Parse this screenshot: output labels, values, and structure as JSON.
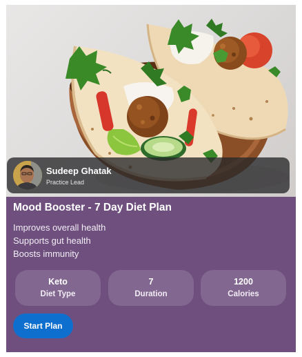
{
  "author": {
    "name": "Sudeep Ghatak",
    "role": "Practice Lead"
  },
  "plan": {
    "title": "Mood Booster - 7 Day Diet Plan",
    "benefits": [
      "Improves overall health",
      "Supports gut health",
      "Boosts immunity"
    ]
  },
  "stats": [
    {
      "value": "Keto",
      "label": "Diet Type"
    },
    {
      "value": "7",
      "label": "Duration"
    },
    {
      "value": "1200",
      "label": "Calories"
    }
  ],
  "actions": {
    "start_label": "Start Plan"
  },
  "colors": {
    "card_background": "#6e4f7e",
    "button": "#0f6fcf",
    "author_bar": "#28282a"
  },
  "hero_image": {
    "subject": "falafel-pita-wraps-in-wooden-bowl"
  }
}
